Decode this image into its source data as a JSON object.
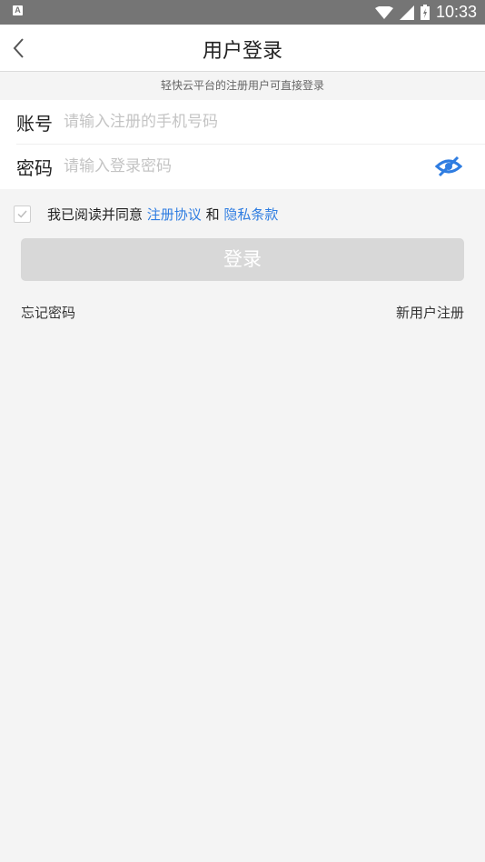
{
  "status_bar": {
    "notification_icon": "A",
    "time": "10:33",
    "icons": [
      "wifi-icon",
      "signal-icon",
      "battery-icon"
    ]
  },
  "header": {
    "title": "用户登录",
    "back_icon": "chevron-left-icon"
  },
  "subtitle": "轻快云平台的注册用户可直接登录",
  "form": {
    "account_label": "账号",
    "account_value": "",
    "account_placeholder": "请输入注册的手机号码",
    "password_label": "密码",
    "password_value": "",
    "password_placeholder": "请输入登录密码",
    "password_toggle_icon": "eye-slash-icon"
  },
  "agreement": {
    "checked": true,
    "prefix": "我已阅读并同意",
    "terms_link": "注册协议",
    "conjunction": "和",
    "privacy_link": "隐私条款"
  },
  "login_button": "登录",
  "footer_links": {
    "forgot_password": "忘记密码",
    "register": "新用户注册"
  },
  "colors": {
    "accent": "#2f7de1",
    "status_bar": "#757575",
    "button_disabled": "#d8d8d8",
    "background": "#f4f4f4"
  }
}
